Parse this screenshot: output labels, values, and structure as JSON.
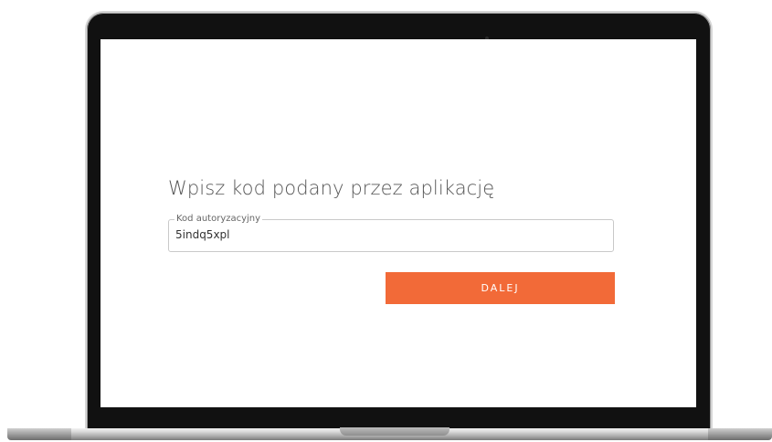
{
  "page": {
    "heading": "Wpisz kod podany przez aplikację",
    "code_field": {
      "label": "Kod autoryzacyjny",
      "value": "5indq5xpl"
    },
    "submit_label": "DALEJ"
  },
  "colors": {
    "accent": "#f26a38",
    "bezel": "#111111",
    "heading_text": "#555555",
    "field_border": "#c9c9c9"
  }
}
